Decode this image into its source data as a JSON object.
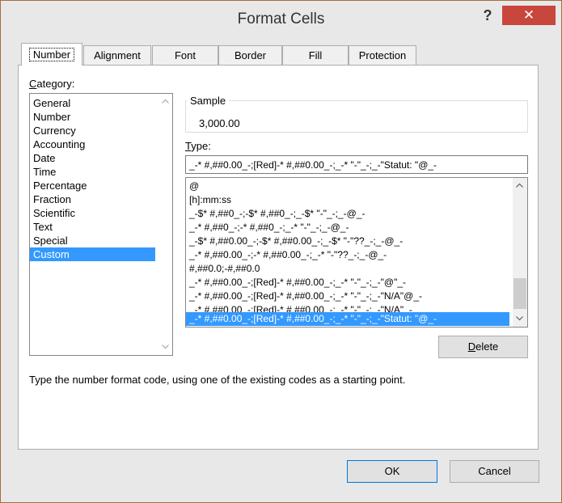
{
  "window": {
    "title": "Format Cells",
    "help_label": "?",
    "close_label": "✕"
  },
  "tabs": [
    {
      "label": "Number",
      "active": true
    },
    {
      "label": "Alignment",
      "active": false
    },
    {
      "label": "Font",
      "active": false
    },
    {
      "label": "Border",
      "active": false
    },
    {
      "label": "Fill",
      "active": false
    },
    {
      "label": "Protection",
      "active": false
    }
  ],
  "category": {
    "label_first": "C",
    "label_rest": "ategory:",
    "items": [
      "General",
      "Number",
      "Currency",
      "Accounting",
      "Date",
      "Time",
      "Percentage",
      "Fraction",
      "Scientific",
      "Text",
      "Special",
      "Custom"
    ],
    "selected": "Custom"
  },
  "sample": {
    "label": "Sample",
    "value": "3,000.00"
  },
  "type": {
    "label_first": "T",
    "label_rest": "ype:",
    "value": "_-* #,##0.00_-;[Red]-* #,##0.00_-;_-* \"-\"_-;_-\"Statut: \"@_-"
  },
  "formats": [
    "@",
    "[h]:mm:ss",
    "_-$* #,##0_-;-$* #,##0_-;_-$* \"-\"_-;_-@_-",
    "_-* #,##0_-;-* #,##0_-;_-* \"-\"_-;_-@_-",
    "_-$* #,##0.00_-;-$* #,##0.00_-;_-$* \"-\"??_-;_-@_-",
    "_-* #,##0.00_-;-* #,##0.00_-;_-* \"-\"??_-;_-@_-",
    "#,##0.0;-#,##0.0",
    "_-* #,##0.00_-;[Red]-* #,##0.00_-;_-* \"-\"_-;_-\"@\"_-",
    "_-* #,##0.00_-;[Red]-* #,##0.00_-;_-* \"-\"_-;_-\"N/A\"@_-",
    "_-* #,##0.00_-;[Red]-* #,##0.00_-;_-* \"-\"_-;_-\"N/A\"_-",
    "_-* #,##0.00_-;[Red]-* #,##0.00_-;_-* \"-\"_-;_-\"Statut: \"@_-"
  ],
  "selected_format_index": 10,
  "delete_label_first": "D",
  "delete_label_rest": "elete",
  "description": "Type the number format code, using one of the existing codes as a starting point.",
  "buttons": {
    "ok": "OK",
    "cancel": "Cancel"
  },
  "icons": {
    "scroll_up": "chevron-up-icon",
    "scroll_down": "chevron-down-icon"
  }
}
